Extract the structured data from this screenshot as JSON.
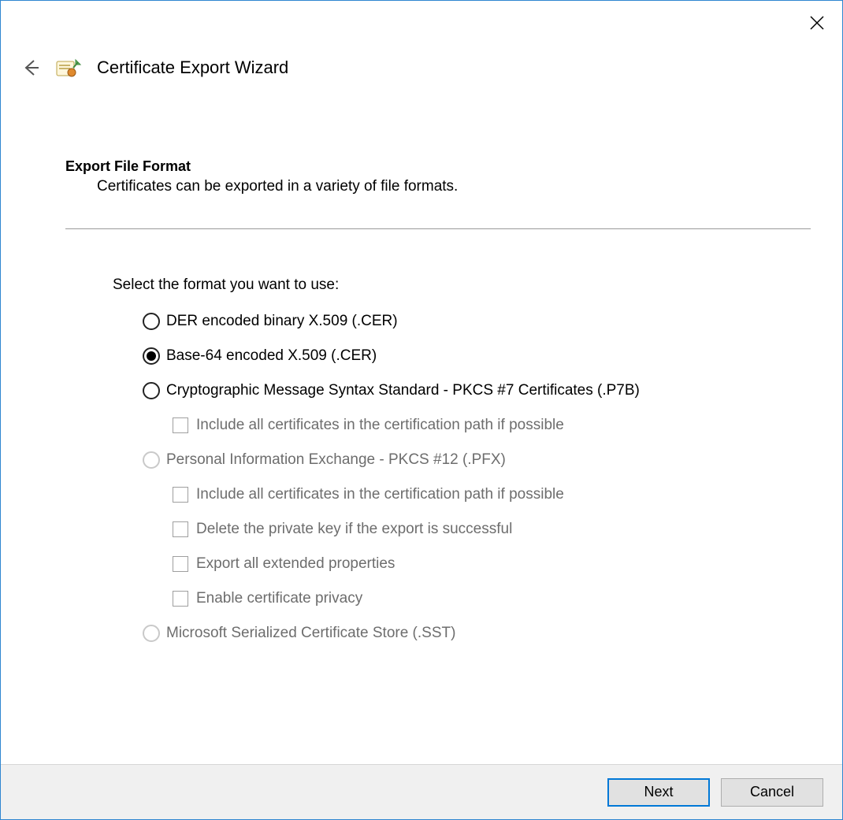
{
  "header": {
    "title": "Certificate Export Wizard"
  },
  "section": {
    "title": "Export File Format",
    "subtitle": "Certificates can be exported in a variety of file formats."
  },
  "prompt": "Select the format you want to use:",
  "options": {
    "der": {
      "label": "DER encoded binary X.509 (.CER)",
      "selected": false,
      "enabled": true
    },
    "b64": {
      "label": "Base-64 encoded X.509 (.CER)",
      "selected": true,
      "enabled": true
    },
    "p7b": {
      "label": "Cryptographic Message Syntax Standard - PKCS #7 Certificates (.P7B)",
      "selected": false,
      "enabled": true,
      "sub": [
        {
          "label": "Include all certificates in the certification path if possible",
          "checked": false,
          "enabled": false
        }
      ]
    },
    "pfx": {
      "label": "Personal Information Exchange - PKCS #12 (.PFX)",
      "selected": false,
      "enabled": false,
      "sub": [
        {
          "label": "Include all certificates in the certification path if possible",
          "checked": false,
          "enabled": false
        },
        {
          "label": "Delete the private key if the export is successful",
          "checked": false,
          "enabled": false
        },
        {
          "label": "Export all extended properties",
          "checked": false,
          "enabled": false
        },
        {
          "label": "Enable certificate privacy",
          "checked": false,
          "enabled": false
        }
      ]
    },
    "sst": {
      "label": "Microsoft Serialized Certificate Store (.SST)",
      "selected": false,
      "enabled": false
    }
  },
  "buttons": {
    "next": "Next",
    "cancel": "Cancel"
  }
}
